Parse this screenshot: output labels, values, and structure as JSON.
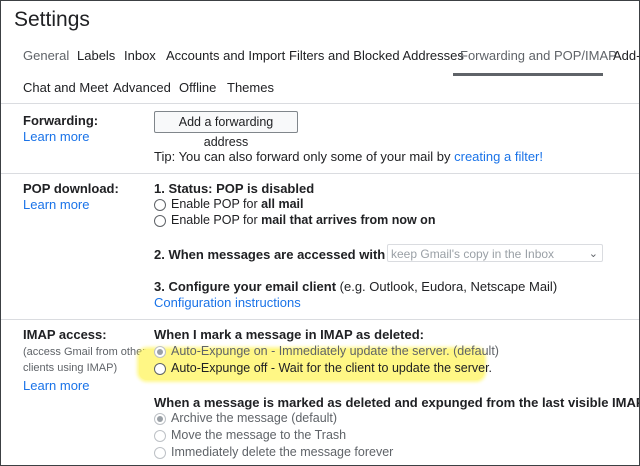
{
  "header": {
    "title": "Settings"
  },
  "tabs_row1": [
    {
      "label": "General"
    },
    {
      "label": "Labels"
    },
    {
      "label": "Inbox"
    },
    {
      "label": "Accounts and Import"
    },
    {
      "label": "Filters and Blocked Addresses"
    },
    {
      "label": "Forwarding and POP/IMAP"
    },
    {
      "label": "Add-"
    }
  ],
  "tabs_row2": [
    {
      "label": "Chat and Meet"
    },
    {
      "label": "Advanced"
    },
    {
      "label": "Offline"
    },
    {
      "label": "Themes"
    }
  ],
  "forwarding": {
    "label": "Forwarding:",
    "learn_more": "Learn more",
    "add_button": "Add a forwarding address",
    "tip_prefix": "Tip: You can also forward only some of your mail by ",
    "tip_link": "creating a filter!"
  },
  "pop": {
    "label": "POP download:",
    "learn_more": "Learn more",
    "status_prefix": "1. Status: ",
    "status_value": "POP is disabled",
    "opt1_prefix": "Enable POP for ",
    "opt1_bold": "all mail",
    "opt2_prefix": "Enable POP for ",
    "opt2_bold": "mail that arrives from now on",
    "step2": "2. When messages are accessed with POP",
    "step2_select": "keep Gmail's copy in the Inbox",
    "step3_bold": "3. Configure your email client",
    "step3_rest": " (e.g. Outlook, Eudora, Netscape Mail)",
    "config_link": "Configuration instructions"
  },
  "imap": {
    "label": "IMAP access:",
    "sub1": "(access Gmail from other",
    "sub2": "clients using IMAP)",
    "learn_more": "Learn more",
    "deleted_heading": "When I mark a message in IMAP as deleted:",
    "expunge_on": "Auto-Expunge on - Immediately update the server. (default)",
    "expunge_off": "Auto-Expunge off - Wait for the client to update the server.",
    "expunged_heading": "When a message is marked as deleted and expunged from the last visible IMAP folder:",
    "archive": "Archive the message (default)",
    "trash": "Move the message to the Trash",
    "delete_forever": "Immediately delete the message forever"
  },
  "colors": {
    "link": "#1a73e8",
    "highlight": "#fff785",
    "tab_active": "#5f6368"
  }
}
